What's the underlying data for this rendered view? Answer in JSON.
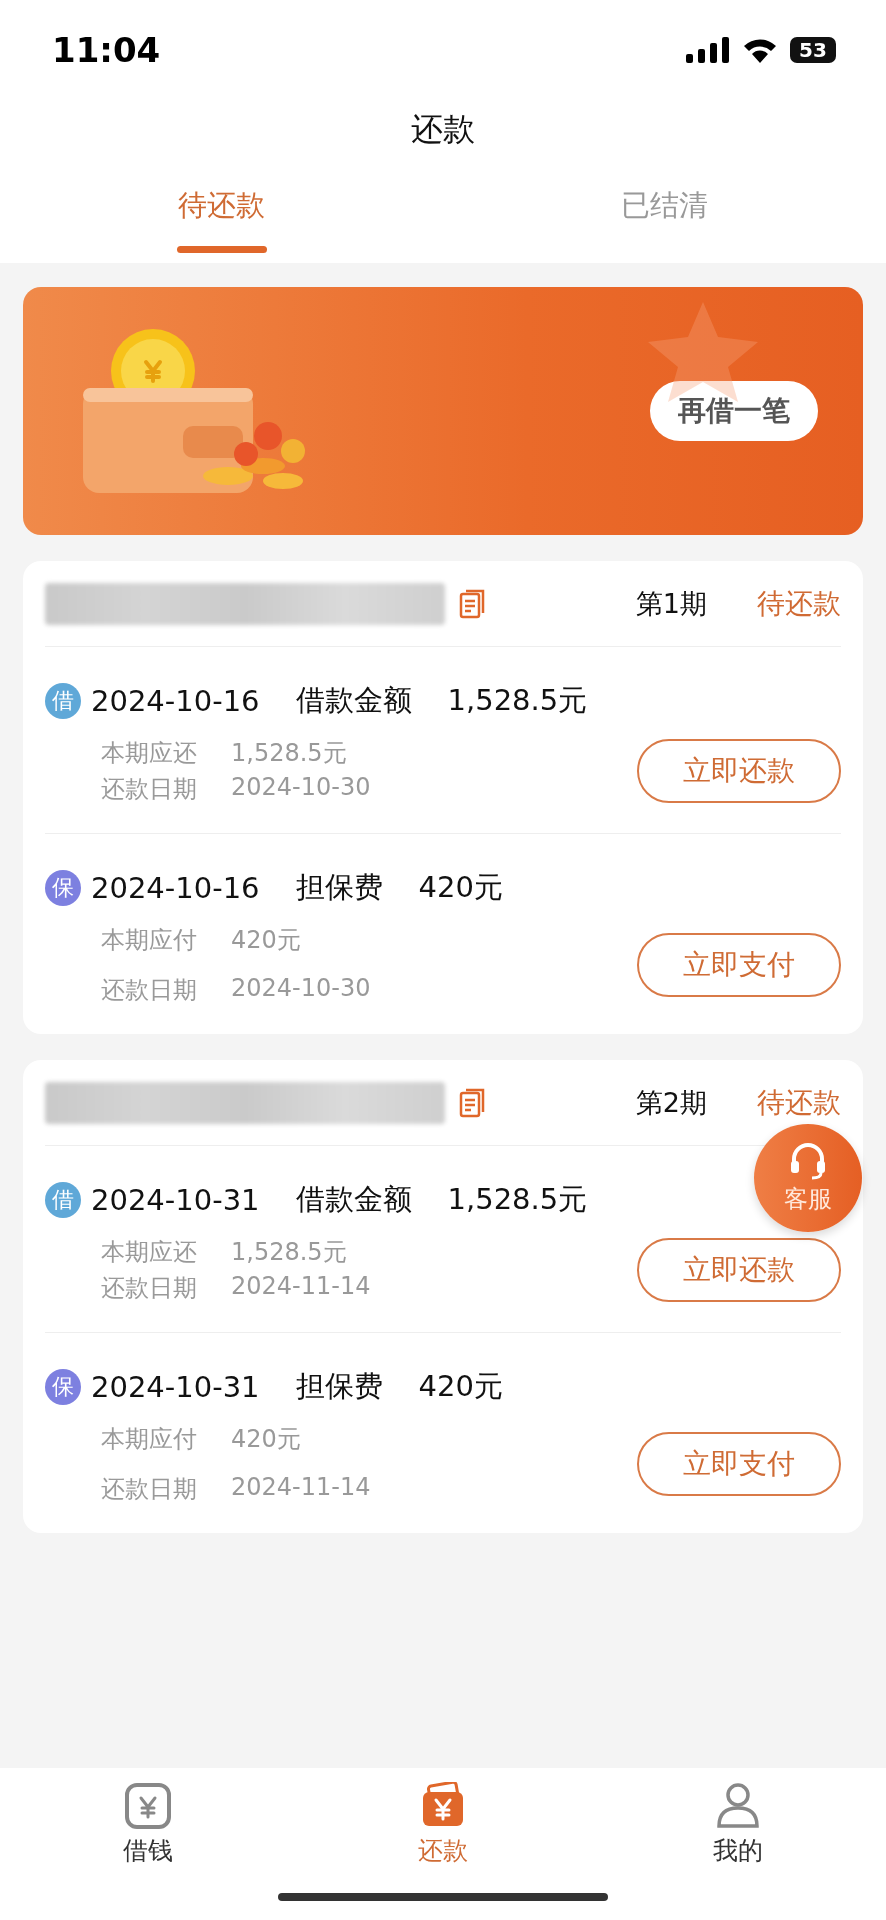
{
  "status_bar": {
    "time": "11:04",
    "battery": "53"
  },
  "header": {
    "title": "还款"
  },
  "tabs": [
    {
      "label": "待还款",
      "selected": true
    },
    {
      "label": "已结清",
      "selected": false
    }
  ],
  "banner": {
    "button": "再借一笔"
  },
  "periods": [
    {
      "period": "第1期",
      "status": "待还款",
      "items": [
        {
          "badge": "借",
          "color": "#5fa8d8",
          "date": "2024-10-16",
          "type": "借款金额",
          "amount": "1,528.5元",
          "due_label": "本期应还",
          "due_value": "1,528.5元",
          "date_label": "还款日期",
          "date_value": "2024-10-30",
          "button": "立即还款"
        },
        {
          "badge": "保",
          "color": "#7d80e0",
          "date": "2024-10-16",
          "type": "担保费",
          "amount": "420元",
          "due_label": "本期应付",
          "due_value": "420元",
          "date_label": "还款日期",
          "date_value": "2024-10-30",
          "button": "立即支付"
        }
      ]
    },
    {
      "period": "第2期",
      "status": "待还款",
      "items": [
        {
          "badge": "借",
          "color": "#5fa8d8",
          "date": "2024-10-31",
          "type": "借款金额",
          "amount": "1,528.5元",
          "due_label": "本期应还",
          "due_value": "1,528.5元",
          "date_label": "还款日期",
          "date_value": "2024-11-14",
          "button": "立即还款"
        },
        {
          "badge": "保",
          "color": "#7d80e0",
          "date": "2024-10-31",
          "type": "担保费",
          "amount": "420元",
          "due_label": "本期应付",
          "due_value": "420元",
          "date_label": "还款日期",
          "date_value": "2024-11-14",
          "button": "立即支付"
        }
      ]
    }
  ],
  "float_button": {
    "label": "客服"
  },
  "bottom_nav": [
    {
      "label": "借钱",
      "kind": "yuan",
      "selected": false
    },
    {
      "label": "还款",
      "kind": "wallet",
      "selected": true
    },
    {
      "label": "我的",
      "kind": "person",
      "selected": false
    }
  ]
}
